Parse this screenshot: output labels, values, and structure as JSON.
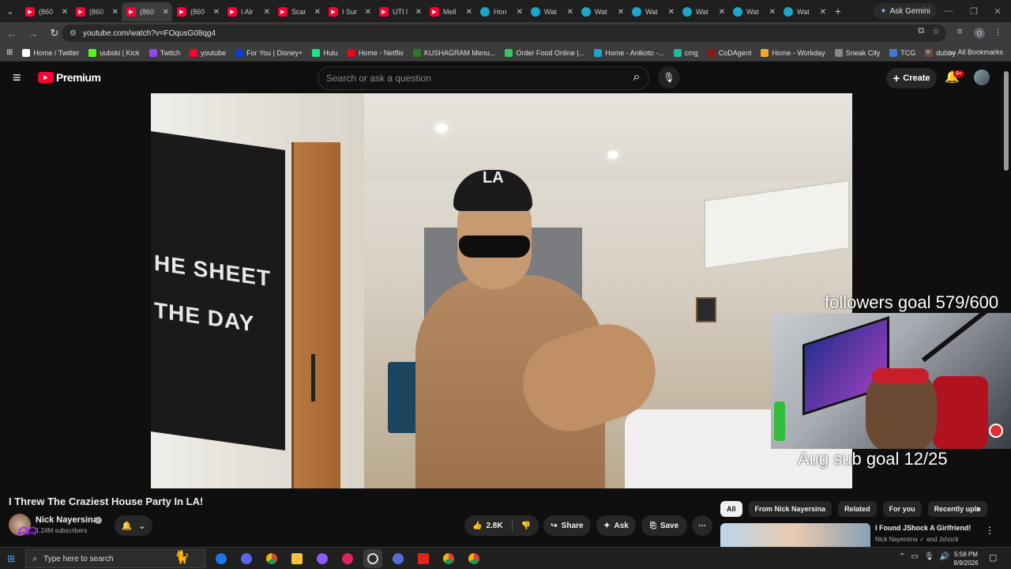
{
  "browser": {
    "tabs": [
      {
        "title": "(860",
        "favicon": "youtube-icon",
        "active": false
      },
      {
        "title": "(860",
        "favicon": "youtube-icon",
        "active": false
      },
      {
        "title": "(860",
        "favicon": "youtube-icon",
        "active": true
      },
      {
        "title": "(860",
        "favicon": "youtube-icon",
        "active": false
      },
      {
        "title": "I Alr",
        "favicon": "youtube-icon",
        "active": false
      },
      {
        "title": "Scar",
        "favicon": "youtube-icon",
        "active": false
      },
      {
        "title": "I Sur",
        "favicon": "youtube-icon",
        "active": false
      },
      {
        "title": "UTI l",
        "favicon": "youtube-icon",
        "active": false
      },
      {
        "title": "Mell",
        "favicon": "youtube-icon",
        "active": false
      },
      {
        "title": "Hon",
        "favicon": "globe-icon",
        "active": false
      },
      {
        "title": "Wat",
        "favicon": "globe-icon",
        "active": false
      },
      {
        "title": "Wat",
        "favicon": "globe-icon",
        "active": false
      },
      {
        "title": "Wat",
        "favicon": "globe-icon",
        "active": false
      },
      {
        "title": "Wat",
        "favicon": "globe-icon",
        "active": false
      },
      {
        "title": "Wat",
        "favicon": "globe-icon",
        "active": false
      },
      {
        "title": "Wat",
        "favicon": "globe-icon",
        "active": false
      }
    ],
    "gemini_label": "Ask Gemini",
    "url": "youtube.com/watch?v=FOqusG08qg4",
    "profile_initial": "O",
    "bookmarks": [
      {
        "label": "Home / Twitter",
        "color": "#ffffff"
      },
      {
        "label": "uubski | Kick",
        "color": "#53fc18"
      },
      {
        "label": "Twitch",
        "color": "#9146ff"
      },
      {
        "label": "youtube",
        "color": "#ff0033"
      },
      {
        "label": "For You | Disney+",
        "color": "#113ccf"
      },
      {
        "label": "Hulu",
        "color": "#1ce783"
      },
      {
        "label": "Home - Netflix",
        "color": "#e50914"
      },
      {
        "label": "KUSHAGRAM Menu...",
        "color": "#2b7a2b"
      },
      {
        "label": "Order Food Online |...",
        "color": "#34c759"
      },
      {
        "label": "Home - Anikoto -...",
        "color": "#1aa7c9"
      },
      {
        "label": "cmg",
        "color": "#1abc9c"
      },
      {
        "label": "CoDAgent",
        "color": "#8b1a1a"
      },
      {
        "label": "Home - Workday",
        "color": "#f5a623"
      },
      {
        "label": "Sneak City",
        "color": "#888888"
      },
      {
        "label": "TCG",
        "color": "#3a7bd5"
      },
      {
        "label": "dubby",
        "color": "#6d4c41"
      }
    ],
    "all_bookmarks_label": "All Bookmarks"
  },
  "youtube": {
    "logo_text": "Premium",
    "search_placeholder": "Search or ask a question",
    "create_label": "Create",
    "notif_badge": "9+",
    "video": {
      "title": "I Threw The Craziest House Party In LA!",
      "flag_line1": "HE SHEET",
      "flag_line2": "THE DAY"
    },
    "overlay": {
      "followers_goal": "followers goal 579/600",
      "sub_goal": "Aug sub goal 12/25",
      "followers_progress": 0.965,
      "sub_progress": 0.48
    },
    "channel": {
      "name": "Nick Nayersina",
      "subscribers": "1.24M subscribers"
    },
    "actions": {
      "likes": "2.8K",
      "share": "Share",
      "ask": "Ask",
      "save": "Save"
    },
    "chips": [
      "All",
      "From Nick Nayersina",
      "Related",
      "For you",
      "Recently uplo"
    ],
    "recommended": {
      "title": "I Found JShock A Girlfriend!",
      "meta_channel": "Nick Nayersina",
      "meta_rest": "and Jshock"
    }
  },
  "taskbar": {
    "search_placeholder": "Type here to search",
    "time": "5:58 PM",
    "date": "8/9/2026"
  }
}
